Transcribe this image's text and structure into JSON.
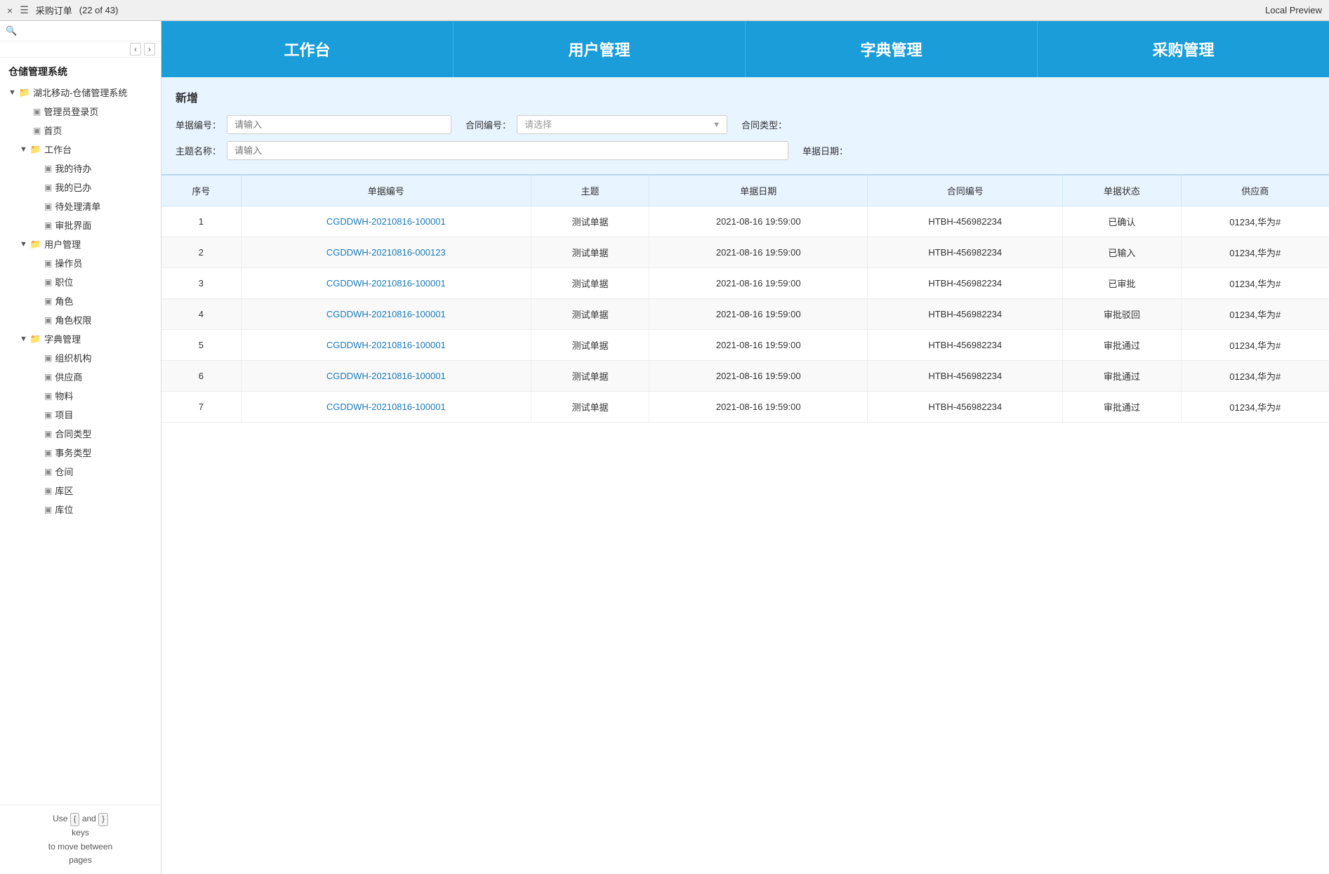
{
  "topbar": {
    "close_icon": "×",
    "menu_icon": "☰",
    "title": "采购订单",
    "subtitle": "(22 of 43)",
    "local_preview": "Local Preview"
  },
  "sidebar": {
    "title": "仓储管理系统",
    "search_placeholder": "",
    "tree": [
      {
        "id": "root",
        "label": "湖北移动-仓储管理系统",
        "level": 1,
        "type": "folder",
        "expanded": true
      },
      {
        "id": "admin",
        "label": "管理员登录页",
        "level": 2,
        "type": "doc"
      },
      {
        "id": "home",
        "label": "首页",
        "level": 2,
        "type": "doc"
      },
      {
        "id": "workbench",
        "label": "工作台",
        "level": 2,
        "type": "folder",
        "expanded": true
      },
      {
        "id": "mytodo",
        "label": "我的待办",
        "level": 3,
        "type": "doc"
      },
      {
        "id": "mydone",
        "label": "我的已办",
        "level": 3,
        "type": "doc"
      },
      {
        "id": "pending",
        "label": "待处理清单",
        "level": 3,
        "type": "doc"
      },
      {
        "id": "approve",
        "label": "审批界面",
        "level": 3,
        "type": "doc"
      },
      {
        "id": "usermgmt",
        "label": "用户管理",
        "level": 2,
        "type": "folder",
        "expanded": true
      },
      {
        "id": "operator",
        "label": "操作员",
        "level": 3,
        "type": "doc"
      },
      {
        "id": "position",
        "label": "职位",
        "level": 3,
        "type": "doc"
      },
      {
        "id": "role",
        "label": "角色",
        "level": 3,
        "type": "doc"
      },
      {
        "id": "roleperm",
        "label": "角色权限",
        "level": 3,
        "type": "doc"
      },
      {
        "id": "dictmgmt",
        "label": "字典管理",
        "level": 2,
        "type": "folder",
        "expanded": true
      },
      {
        "id": "org",
        "label": "组织机构",
        "level": 3,
        "type": "doc"
      },
      {
        "id": "supplier",
        "label": "供应商",
        "level": 3,
        "type": "doc"
      },
      {
        "id": "material",
        "label": "物料",
        "level": 3,
        "type": "doc"
      },
      {
        "id": "project",
        "label": "项目",
        "level": 3,
        "type": "doc"
      },
      {
        "id": "contracttype",
        "label": "合同类型",
        "level": 3,
        "type": "doc"
      },
      {
        "id": "biztype",
        "label": "事务类型",
        "level": 3,
        "type": "doc"
      },
      {
        "id": "warehouse",
        "label": "仓间",
        "level": 3,
        "type": "doc"
      },
      {
        "id": "zone",
        "label": "库区",
        "level": 3,
        "type": "doc"
      },
      {
        "id": "location",
        "label": "库位",
        "level": 3,
        "type": "doc"
      }
    ],
    "bottom_hint": "Use",
    "bottom_key1": "{",
    "bottom_and": "and",
    "bottom_key2": "}",
    "bottom_keys_label": "keys",
    "bottom_move": "to move between",
    "bottom_pages": "pages"
  },
  "nav": {
    "items": [
      {
        "id": "workbench",
        "label": "工作台"
      },
      {
        "id": "usermgmt",
        "label": "用户管理"
      },
      {
        "id": "dictmgmt",
        "label": "字典管理"
      },
      {
        "id": "purchasemgmt",
        "label": "采购管理"
      }
    ]
  },
  "form": {
    "title": "新增",
    "fields": {
      "doc_no_label": "单据编号：",
      "doc_no_placeholder": "请输入",
      "contract_no_label": "合同编号：",
      "contract_no_placeholder": "请选择",
      "contract_type_label": "合同类型：",
      "theme_label": "主题名称：",
      "theme_placeholder": "请输入",
      "doc_date_label": "单据日期："
    }
  },
  "table": {
    "columns": [
      "序号",
      "单据编号",
      "主题",
      "单据日期",
      "合同编号",
      "单据状态",
      "供应商"
    ],
    "rows": [
      {
        "seq": "1",
        "doc_no": "CGDDWH-20210816-100001",
        "theme": "测试单据",
        "doc_date": "2021-08-16 19:59:00",
        "contract_no": "HTBH-456982234",
        "status": "已确认",
        "supplier": "01234,华为#"
      },
      {
        "seq": "2",
        "doc_no": "CGDDWH-20210816-000123",
        "theme": "测试单据",
        "doc_date": "2021-08-16 19:59:00",
        "contract_no": "HTBH-456982234",
        "status": "已输入",
        "supplier": "01234,华为#"
      },
      {
        "seq": "3",
        "doc_no": "CGDDWH-20210816-100001",
        "theme": "测试单据",
        "doc_date": "2021-08-16 19:59:00",
        "contract_no": "HTBH-456982234",
        "status": "已审批",
        "supplier": "01234,华为#"
      },
      {
        "seq": "4",
        "doc_no": "CGDDWH-20210816-100001",
        "theme": "测试单据",
        "doc_date": "2021-08-16 19:59:00",
        "contract_no": "HTBH-456982234",
        "status": "审批驳回",
        "supplier": "01234,华为#"
      },
      {
        "seq": "5",
        "doc_no": "CGDDWH-20210816-100001",
        "theme": "测试单据",
        "doc_date": "2021-08-16 19:59:00",
        "contract_no": "HTBH-456982234",
        "status": "审批通过",
        "supplier": "01234,华为#"
      },
      {
        "seq": "6",
        "doc_no": "CGDDWH-20210816-100001",
        "theme": "测试单据",
        "doc_date": "2021-08-16 19:59:00",
        "contract_no": "HTBH-456982234",
        "status": "审批通过",
        "supplier": "01234,华为#"
      },
      {
        "seq": "7",
        "doc_no": "CGDDWH-20210816-100001",
        "theme": "测试单据",
        "doc_date": "2021-08-16 19:59:00",
        "contract_no": "HTBH-456982234",
        "status": "审批通过",
        "supplier": "01234,华为#"
      }
    ]
  }
}
